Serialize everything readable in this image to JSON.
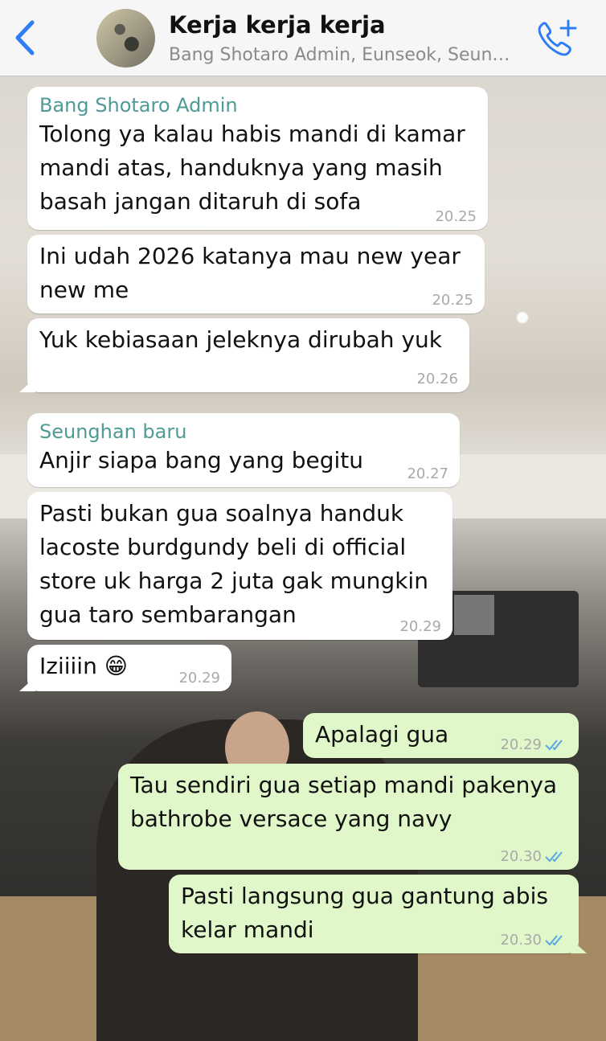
{
  "header": {
    "title": "Kerja kerja kerja",
    "subtitle": "Bang Shotaro Admin, Eunseok, Seun…",
    "back_icon": "chevron-left-icon",
    "call_icon": "add-call-icon",
    "accent_color": "#2f7df6"
  },
  "messages": [
    {
      "sender": "Bang Shotaro Admin",
      "lines": [
        "Tolong ya kalau habis mandi di kamar",
        "mandi atas, handuknya yang masih",
        "basah jangan ditaruh di sofa"
      ],
      "time": "20.25"
    },
    {
      "lines": [
        "Ini udah 2026 katanya mau new year",
        "new me"
      ],
      "time": "20.25"
    },
    {
      "lines": [
        "Yuk kebiasaan jeleknya dirubah yuk"
      ],
      "time": "20.26"
    },
    {
      "sender": "Seunghan baru",
      "lines": [
        "Anjir siapa bang yang begitu"
      ],
      "time": "20.27"
    },
    {
      "lines": [
        "Pasti bukan gua soalnya handuk",
        "lacoste burdgundy beli di official",
        "store uk harga 2 juta gak mungkin",
        "gua taro sembarangan"
      ],
      "time": "20.29"
    },
    {
      "lines": [
        "Iziiiin 😁"
      ],
      "time": "20.29"
    },
    {
      "lines": [
        "Apalagi gua"
      ],
      "time": "20.29",
      "outgoing": true
    },
    {
      "lines": [
        "Tau sendiri gua setiap mandi pakenya",
        "bathrobe versace yang navy"
      ],
      "time": "20.30",
      "outgoing": true
    },
    {
      "lines": [
        "Pasti langsung gua gantung abis",
        "kelar mandi"
      ],
      "time": "20.30",
      "outgoing": true
    }
  ],
  "colors": {
    "incoming_bubble": "#ffffff",
    "outgoing_bubble": "#e0f7c9",
    "sender_name": "#4e9b96",
    "read_ticks": "#5aa7e6"
  }
}
